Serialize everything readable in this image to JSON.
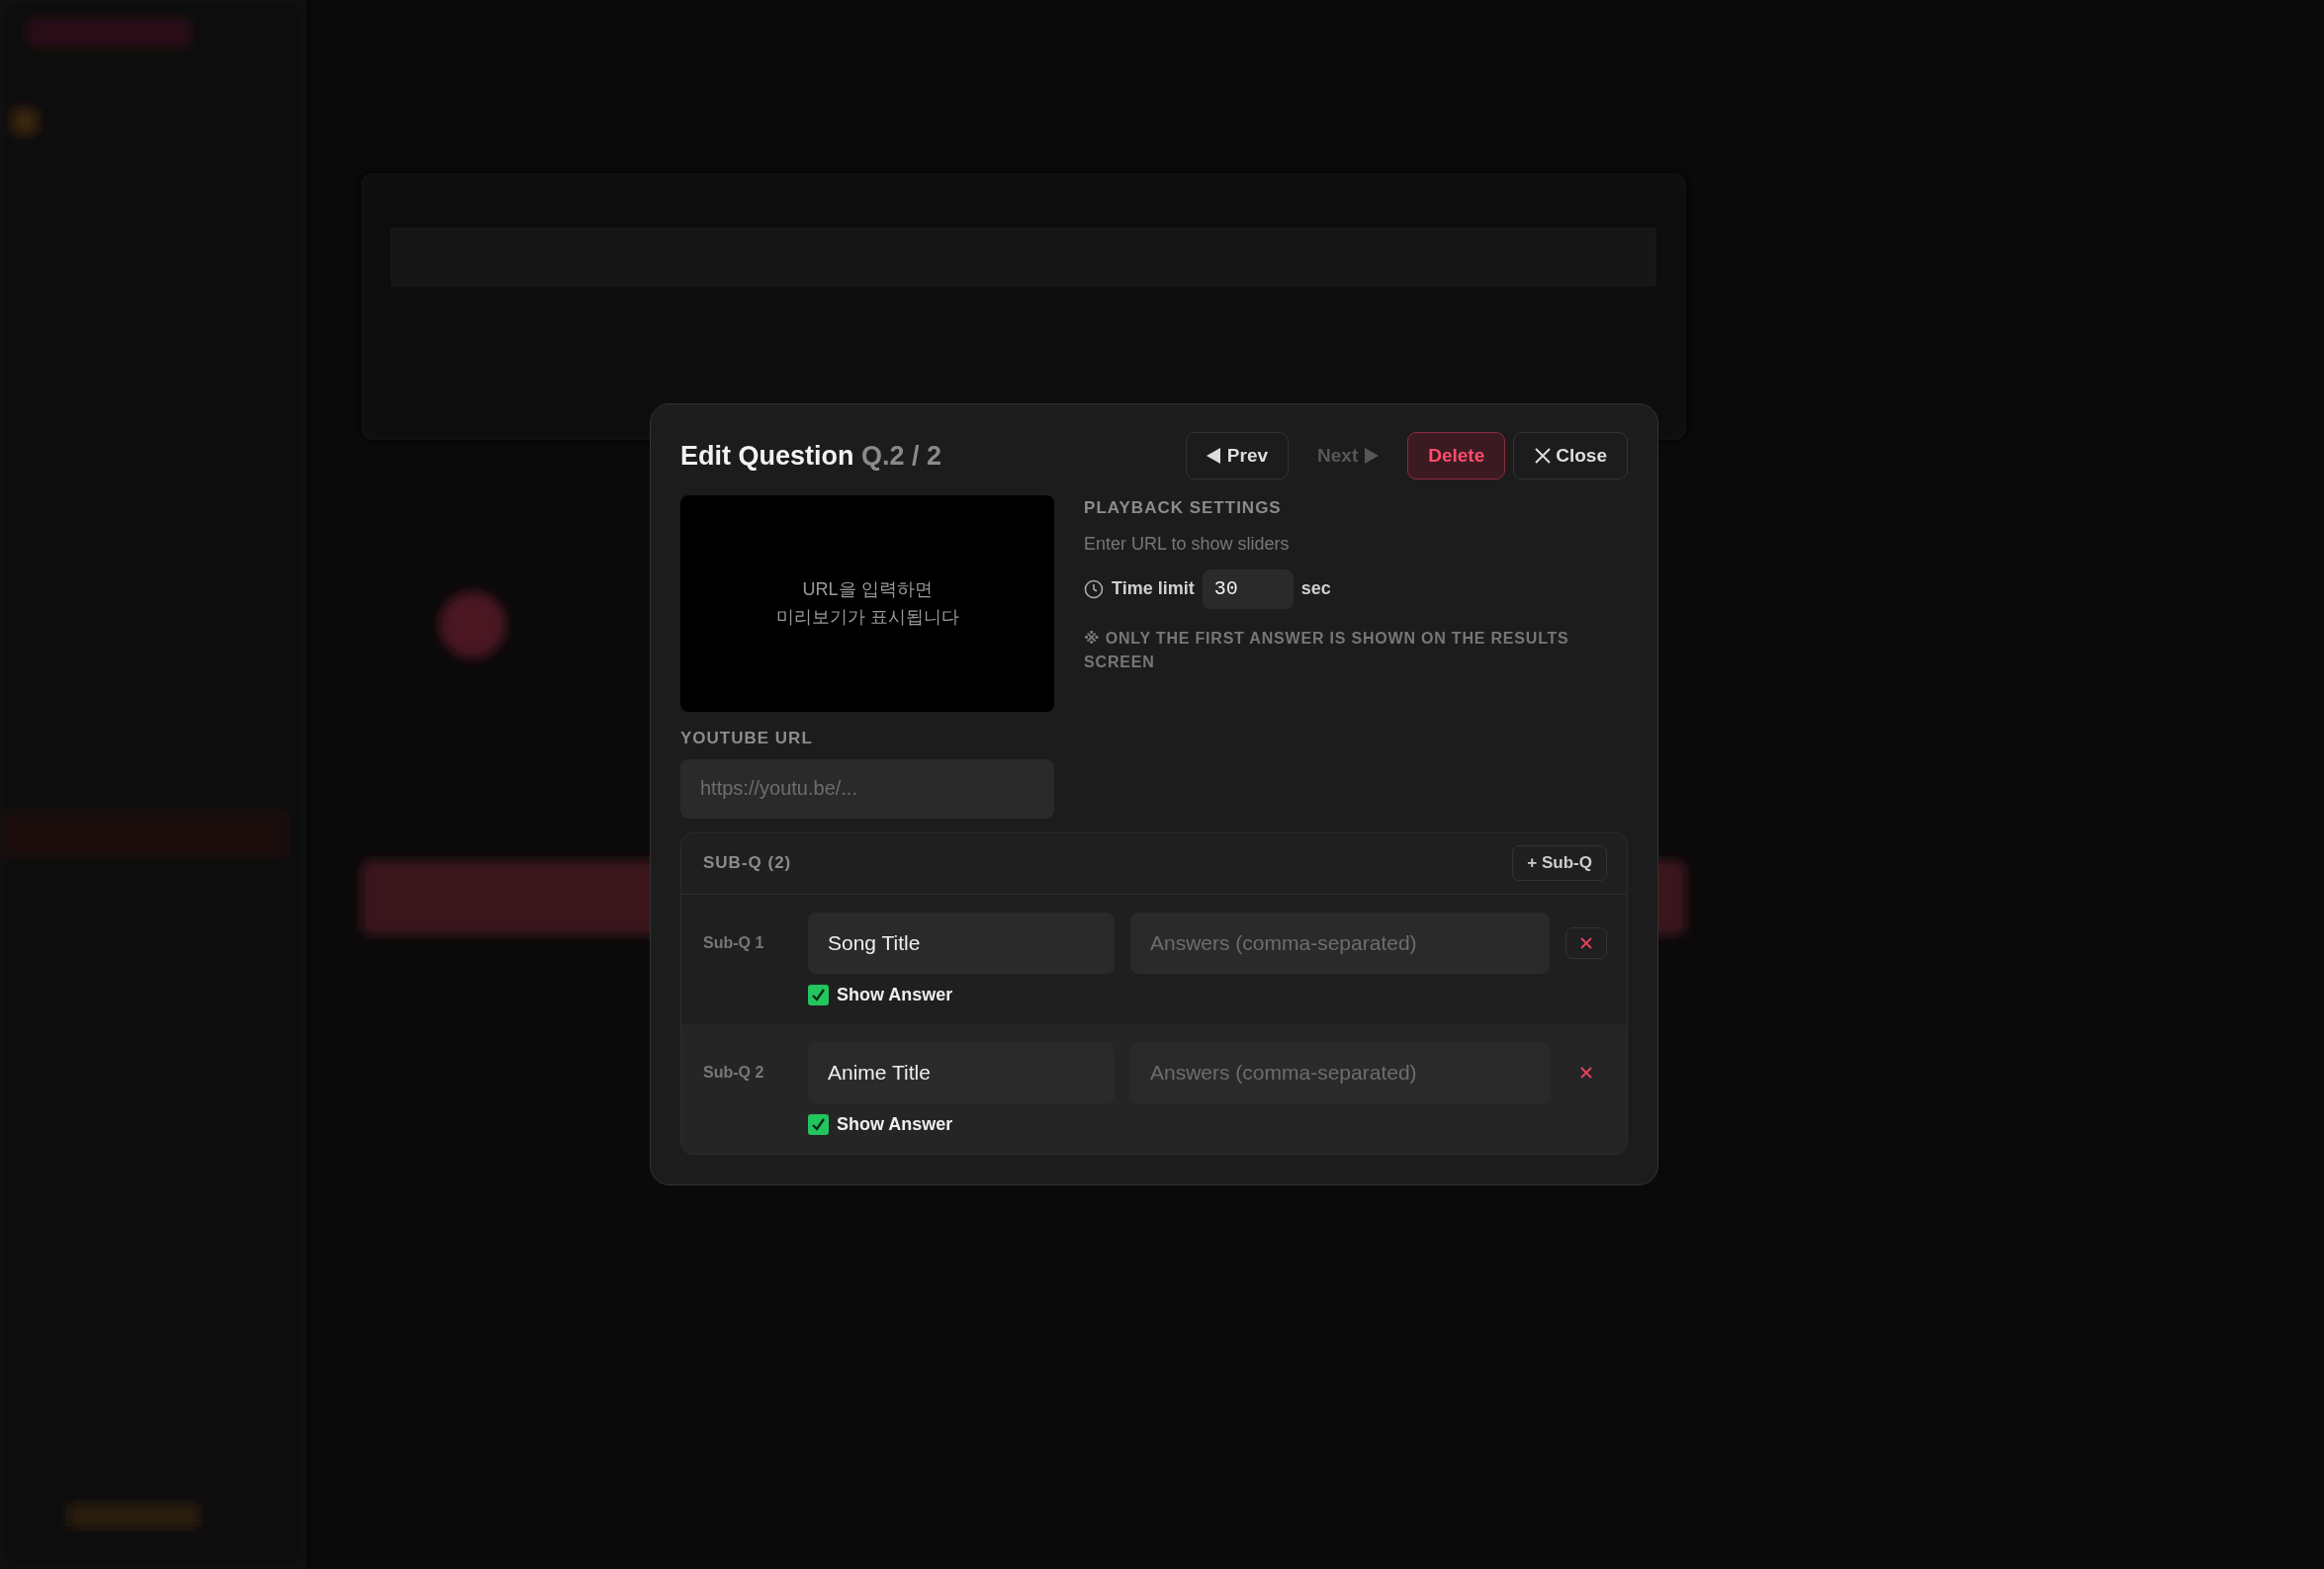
{
  "modal": {
    "title": "Edit Question",
    "counter": "Q.2 / 2",
    "buttons": [
      {
        "kind": "prev",
        "label": "Prev",
        "disabled": false
      },
      {
        "kind": "next",
        "label": "Next",
        "disabled": true
      },
      {
        "kind": "delete",
        "label": "Delete"
      },
      {
        "kind": "close",
        "label": "Close"
      }
    ],
    "preview": {
      "message": [
        "URL을 입력하면",
        "미리보기가 표시됩니다"
      ]
    },
    "youtube_url": {
      "label": "YOUTUBE URL",
      "placeholder": "https://youtu.be/..."
    },
    "playback": {
      "heading": "PLAYBACK SETTINGS",
      "hint": "Enter URL to show sliders",
      "time_limit": {
        "label": "Time limit",
        "value": "30",
        "unit": "sec"
      },
      "note": "※ ONLY THE FIRST ANSWER IS SHOWN ON THE RESULTS SCREEN"
    },
    "sub_questions": {
      "heading": "SUB-Q (2)",
      "add_button": "+ Sub-Q",
      "items": [
        {
          "label": "Sub-Q 1",
          "title": "Song Title",
          "answers_placeholder": "Answers (comma-separated)",
          "show_answer": {
            "label": "Show Answer",
            "checked": true
          },
          "highlighted": false
        },
        {
          "label": "Sub-Q 2",
          "title": "Anime Title",
          "answers_placeholder": "Answers (comma-separated)",
          "show_answer": {
            "label": "Show Answer",
            "checked": true
          },
          "highlighted": true
        }
      ]
    }
  }
}
